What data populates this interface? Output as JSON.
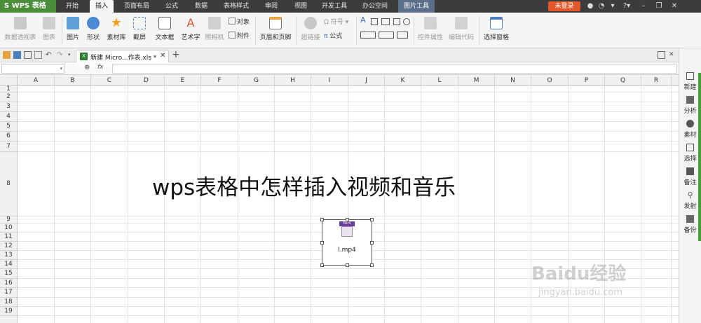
{
  "app": {
    "logo": "S WPS 表格"
  },
  "menu": {
    "tabs": [
      "开始",
      "插入",
      "页面布局",
      "公式",
      "数据",
      "表格样式",
      "审阅",
      "视图",
      "开发工具",
      "办公空间"
    ],
    "active_index": 1,
    "context_tab": "图片工具",
    "login": "未登录"
  },
  "ribbon": {
    "pivot": "数据透视表",
    "chart": "图表",
    "picture": "图片",
    "shapes": "形状",
    "library": "素材库",
    "screenshot": "截屏",
    "textbox": "文本框",
    "wordart": "艺术字",
    "camera": "照相机",
    "object": "对象",
    "attachment": "附件",
    "header_footer": "页眉和页脚",
    "hyperlink": "超链接",
    "symbol": "符号",
    "formula": "公式",
    "control_props": "控件属性",
    "edit_code": "编辑代码",
    "select_pane": "选择窗格"
  },
  "doc_tab": {
    "title": "新建 Micro...作表.xls *"
  },
  "grid": {
    "columns": [
      "A",
      "B",
      "C",
      "D",
      "E",
      "F",
      "G",
      "H",
      "I",
      "J",
      "K",
      "L",
      "M",
      "N",
      "O",
      "P",
      "Q",
      "R"
    ],
    "rows": [
      "1",
      "2",
      "3",
      "4",
      "5",
      "6",
      "7",
      "8",
      "9",
      "10",
      "11",
      "12",
      "13",
      "14",
      "15",
      "16",
      "17",
      "18",
      "19"
    ],
    "big_text": "wps表格中怎样插入视频和音乐"
  },
  "media": {
    "badge": "MP4",
    "filename": "l.mp4"
  },
  "right_panel": [
    "新建",
    "分析",
    "素材",
    "选择",
    "备注",
    "发射",
    "备份"
  ],
  "watermark": {
    "main": "Baidu经验",
    "sub": "jingyan.baidu.com"
  }
}
